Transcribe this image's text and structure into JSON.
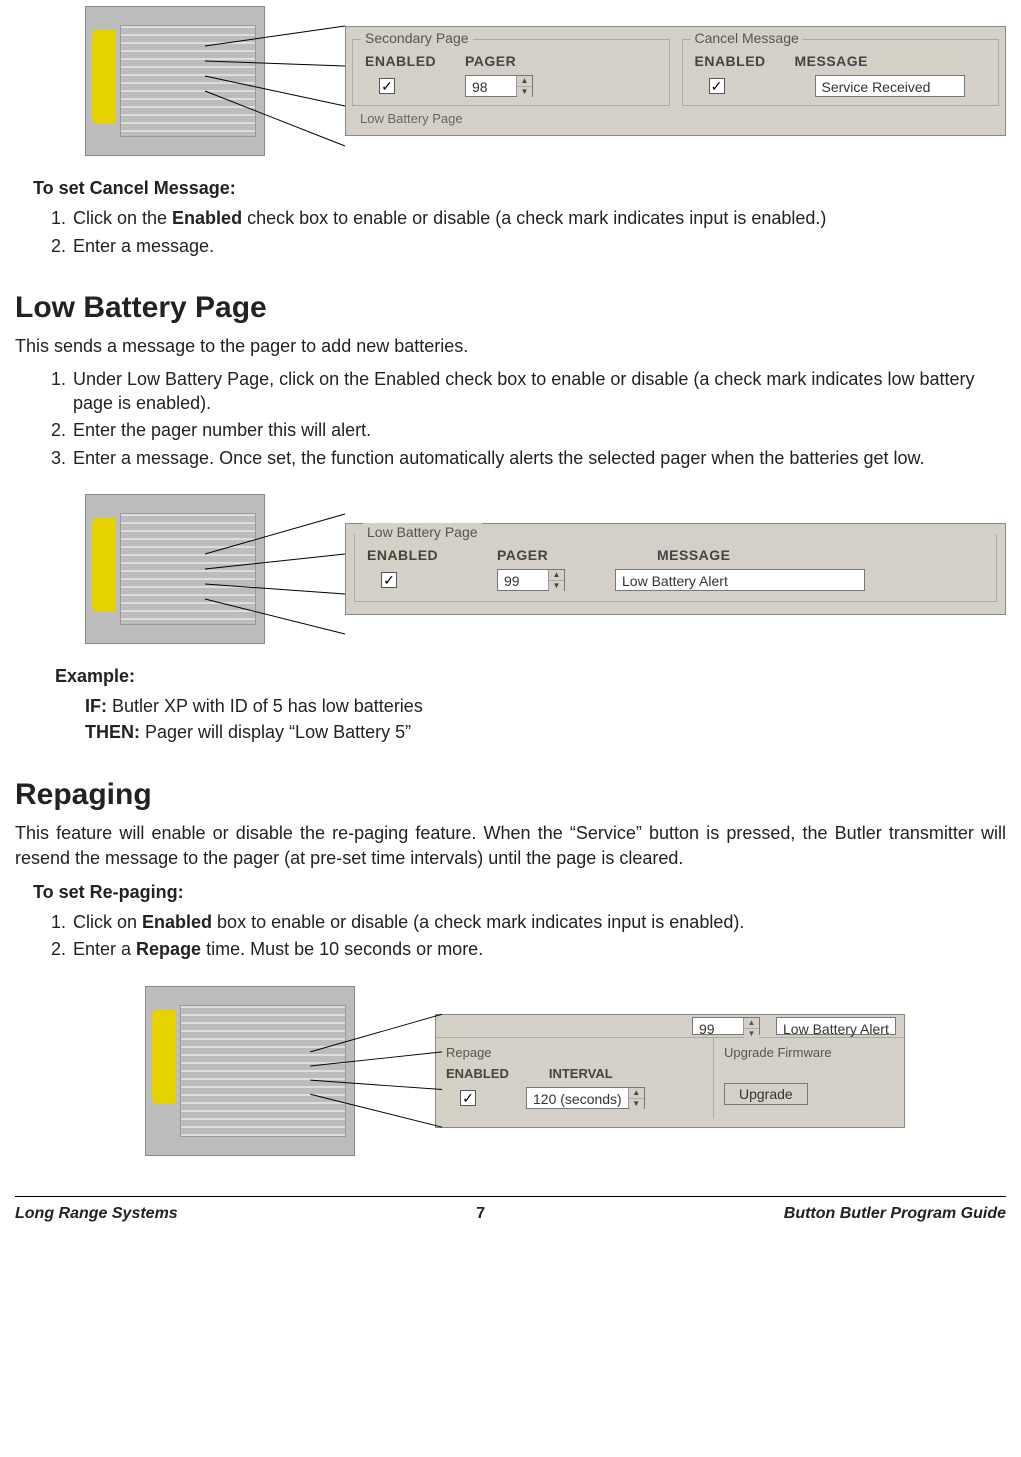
{
  "figure1": {
    "group_left": {
      "legend": "Secondary Page",
      "head_enabled": "ENABLED",
      "head_pager": "PAGER",
      "check": "✓",
      "pager_value": "98"
    },
    "group_right": {
      "legend": "Cancel Message",
      "head_enabled": "ENABLED",
      "head_message": "MESSAGE",
      "check": "✓",
      "message_value": "Service Received"
    },
    "footer_strip": "Low Battery Page"
  },
  "cancel_section": {
    "title": "To set Cancel Message:",
    "step1_pre": "Click on the ",
    "step1_bold": "Enabled",
    "step1_post": " check box to enable or disable (a check mark indicates input is enabled.)",
    "step2": "Enter a message."
  },
  "low_battery": {
    "heading": "Low Battery Page",
    "intro": "This sends a message to the pager to add new batteries.",
    "step1": "Under Low Battery Page, click on the Enabled check box to enable or disable (a check mark indicates low battery page is enabled).",
    "step2": "Enter the pager number this will alert.",
    "step3": "Enter a message. Once set, the function automatically alerts the selected pager when the batteries get low."
  },
  "figure2": {
    "legend": "Low Battery Page",
    "head_enabled": "ENABLED",
    "head_pager": "PAGER",
    "head_message": "MESSAGE",
    "check": "✓",
    "pager_value": "99",
    "message_value": "Low Battery Alert"
  },
  "example": {
    "title": "Example:",
    "if_label": "IF:",
    "if_text": " Butler XP with ID of 5 has low batteries",
    "then_label": "THEN:",
    "then_text": " Pager will display “Low Battery 5”"
  },
  "repaging": {
    "heading": "Repaging",
    "intro": "This feature will enable or disable the re-paging feature. When the “Service” button is pressed, the Butler transmitter will resend the message to the pager (at pre-set time intervals) until the page is cleared.",
    "sub_title": "To set Re-paging:",
    "step1_pre": "Click on ",
    "step1_bold": "Enabled",
    "step1_post": " box to enable or disable (a check mark indicates input is enabled).",
    "step2_pre": "Enter a ",
    "step2_bold": "Repage",
    "step2_post": " time. Must be 10 seconds or more."
  },
  "figure3": {
    "top_num": "99",
    "top_text": "Low Battery Alert",
    "repage_legend": "Repage",
    "head_enabled": "ENABLED",
    "head_interval": "INTERVAL",
    "check": "✓",
    "interval_value": "120 (seconds)",
    "upgrade_legend": "Upgrade Firmware",
    "upgrade_button": "Upgrade"
  },
  "footer": {
    "left": "Long Range Systems",
    "page": "7",
    "right": "Button Butler Program Guide"
  }
}
